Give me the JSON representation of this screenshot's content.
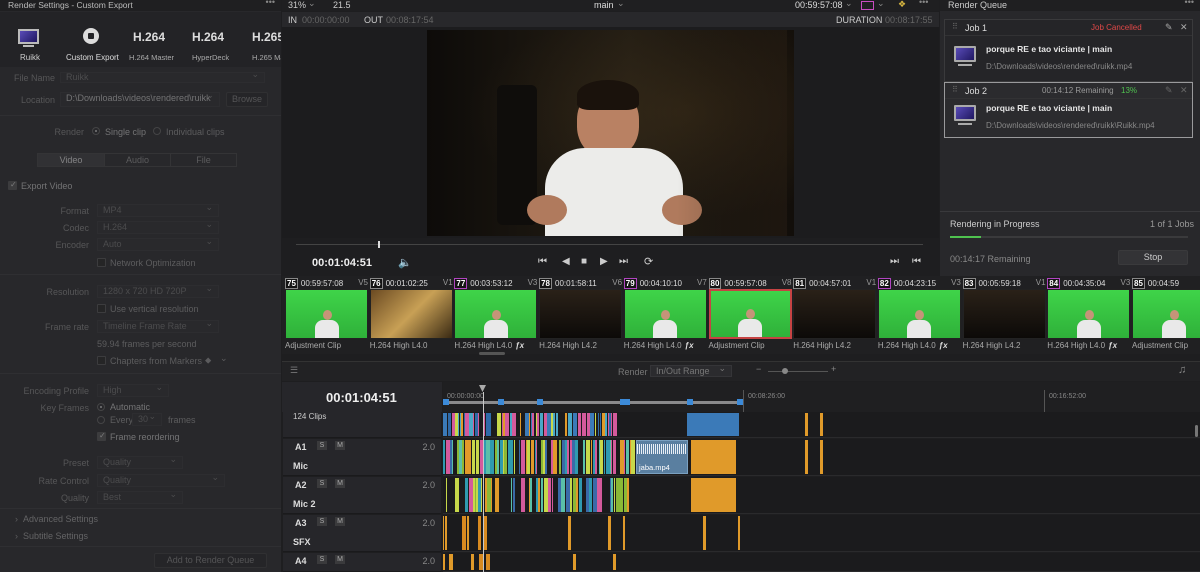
{
  "render_settings": {
    "header": "Render Settings - Custom Export",
    "presets": [
      {
        "label": "Ruikk",
        "big": "",
        "icon": "monitor-icon"
      },
      {
        "label": "Custom Export",
        "big": "",
        "icon": "custom-export-icon"
      },
      {
        "label": "H.264 Master",
        "big": "H.264"
      },
      {
        "label": "HyperDeck",
        "big": "H.264"
      },
      {
        "label": "H.265 Mas",
        "big": "H.265"
      }
    ],
    "file_name_label": "File Name",
    "file_name_value": "Ruikk",
    "location_label": "Location",
    "location_value": "D:\\Downloads\\videos\\rendered\\ruikk",
    "browse": "Browse",
    "render_label": "Render",
    "render_single": "Single clip",
    "render_individual": "Individual clips",
    "tabs": [
      "Video",
      "Audio",
      "File"
    ],
    "export_video": "Export Video",
    "format_label": "Format",
    "format_value": "MP4",
    "codec_label": "Codec",
    "codec_value": "H.264",
    "encoder_label": "Encoder",
    "encoder_value": "Auto",
    "network_opt": "Network Optimization",
    "resolution_label": "Resolution",
    "resolution_value": "1280 x 720 HD 720P",
    "vertical_res": "Use vertical resolution",
    "frame_rate_label": "Frame rate",
    "frame_rate_value": "Timeline Frame Rate",
    "fps_note": "59.94 frames per second",
    "chapters": "Chapters from Markers",
    "encoding_profile_label": "Encoding Profile",
    "encoding_profile_value": "High",
    "key_frames_label": "Key Frames",
    "kf_auto": "Automatic",
    "kf_every": "Every",
    "kf_every_value": "30",
    "kf_frames": "frames",
    "frame_reordering": "Frame reordering",
    "preset_label": "Preset",
    "preset_value": "Quality",
    "rate_control_label": "Rate Control",
    "rate_control_value": "Quality",
    "quality_label": "Quality",
    "quality_value": "Best",
    "advanced": "Advanced Settings",
    "subtitle": "Subtitle Settings",
    "add_queue": "Add to Render Queue"
  },
  "viewer": {
    "zoom": "31%",
    "fps": "21.5",
    "timeline_name": "main",
    "timecode_top": "00:59:57:08",
    "in_label": "IN",
    "in_value": "00:00:00:00",
    "out_label": "OUT",
    "out_value": "00:08:17:54",
    "duration_label": "DURATION",
    "duration_value": "00:08:17:55",
    "current_tc": "00:01:04:51",
    "playhead_fraction": 0.13
  },
  "clips": [
    {
      "num": "75",
      "tc": "00:59:57:08",
      "track": "V5",
      "label": "Adjustment Clip",
      "green": true
    },
    {
      "num": "76",
      "tc": "00:01:02:25",
      "track": "V1",
      "label": "H.264 High L4.0",
      "green": false
    },
    {
      "num": "77",
      "tc": "00:03:53:12",
      "track": "V3",
      "label": "H.264 High L4.0",
      "green": true,
      "fx": true
    },
    {
      "num": "78",
      "tc": "00:01:58:11",
      "track": "V6",
      "label": "H.264 High L4.2",
      "green": false
    },
    {
      "num": "79",
      "tc": "00:04:10:10",
      "track": "V7",
      "label": "H.264 High L4.0",
      "green": true,
      "fx": true
    },
    {
      "num": "80",
      "tc": "00:59:57:08",
      "track": "V8",
      "label": "Adjustment Clip",
      "green": true,
      "selected": true
    },
    {
      "num": "81",
      "tc": "00:04:57:01",
      "track": "V1",
      "label": "H.264 High L4.2",
      "green": false
    },
    {
      "num": "82",
      "tc": "00:04:23:15",
      "track": "V3",
      "label": "H.264 High L4.0",
      "green": true,
      "fx": true
    },
    {
      "num": "83",
      "tc": "00:05:59:18",
      "track": "V1",
      "label": "H.264 High L4.2",
      "green": false
    },
    {
      "num": "84",
      "tc": "00:04:35:04",
      "track": "V3",
      "label": "H.264 High L4.0",
      "green": true,
      "fx": true
    },
    {
      "num": "85",
      "tc": "00:04:59",
      "track": "",
      "label": "Adjustment Clip",
      "green": true
    }
  ],
  "timeline": {
    "render_label": "Render",
    "render_range": "In/Out Range",
    "timecode": "00:01:04:51",
    "ruler": [
      "00:00:00:00",
      "00:08:26:00",
      "00:16:52:00"
    ],
    "clips_count": "124 Clips",
    "tracks": [
      {
        "id": "A1",
        "name": "Mic",
        "vol": "2.0"
      },
      {
        "id": "A2",
        "name": "Mic 2",
        "vol": "2.0"
      },
      {
        "id": "A3",
        "name": "SFX",
        "vol": "2.0"
      },
      {
        "id": "A4",
        "name": "",
        "vol": "2.0"
      }
    ],
    "audio_clip_name": "jaba.mp4"
  },
  "queue": {
    "title": "Render Queue",
    "jobs": [
      {
        "title": "Job 1",
        "status": "Job Cancelled",
        "name": "porque RE e tao viciante | main",
        "path": "D:\\Downloads\\videos\\rendered\\ruikk.mp4"
      },
      {
        "title": "Job 2",
        "status": "00:14:12 Remaining",
        "percent": "13%",
        "name": "porque RE e tao viciante | main",
        "path": "D:\\Downloads\\videos\\rendered\\ruikk\\Ruikk.mp4"
      }
    ],
    "progress_label": "Rendering in Progress",
    "progress_count": "1 of 1 Jobs",
    "remaining": "00:14:17 Remaining",
    "stop": "Stop",
    "progress_fraction": 0.13
  },
  "colors": {
    "accent": "#d9a84e",
    "cancel": "#e04848",
    "percent": "#4fc24f",
    "selected_clip": "#c64343"
  }
}
